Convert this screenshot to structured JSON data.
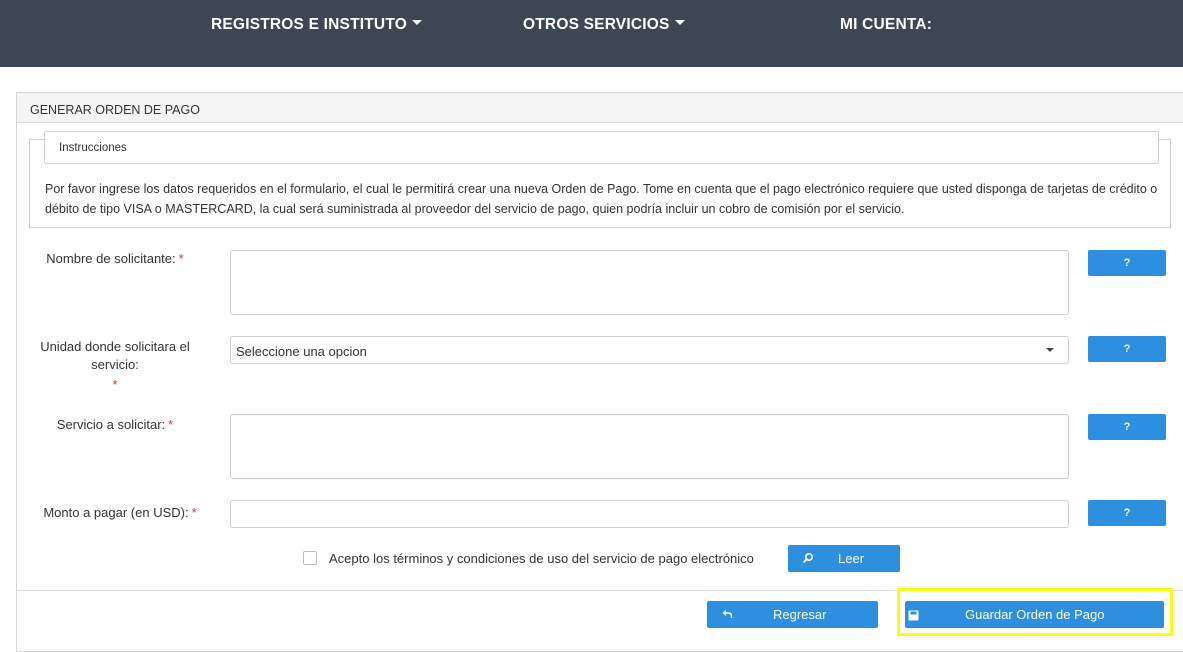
{
  "nav": {
    "item1": "REGISTROS E INSTITUTO",
    "item2": "OTROS SERVICIOS",
    "item3": "MI CUENTA:"
  },
  "panel": {
    "title": "GENERAR ORDEN DE PAGO",
    "instructions_legend": "Instrucciones",
    "instructions_text": "Por favor ingrese los datos requeridos en el formulario, el cual le permitirá crear una nueva Orden de Pago. Tome en cuenta que el pago electrónico requiere que usted disponga de tarjetas de crédito o débito de tipo VISA o MASTERCARD, la cual será suministrada al proveedor del servicio de pago, quien podría incluir un cobro de comisión por el servicio."
  },
  "form": {
    "nombre_label": "Nombre de solicitante:",
    "unidad_label_line1": "Unidad donde solicitara el",
    "unidad_label_line2": "servicio:",
    "unidad_selected": "Seleccione una opcion",
    "servicio_label": "Servicio a solicitar:",
    "monto_label": "Monto a pagar (en USD):",
    "required_mark": "*",
    "help_label": "?",
    "nombre_value": "",
    "servicio_value": "",
    "monto_value": ""
  },
  "terms": {
    "text": "Acepto los términos y condiciones de uso del servicio de pago electrónico",
    "checked": false,
    "leer_label": "Leer"
  },
  "actions": {
    "back_label": "Regresar",
    "save_label": "Guardar Orden de Pago"
  },
  "colors": {
    "navbar": "#3d4654",
    "button": "#2c8fe0",
    "highlight": "#fbfb15",
    "required": "#e03030"
  }
}
